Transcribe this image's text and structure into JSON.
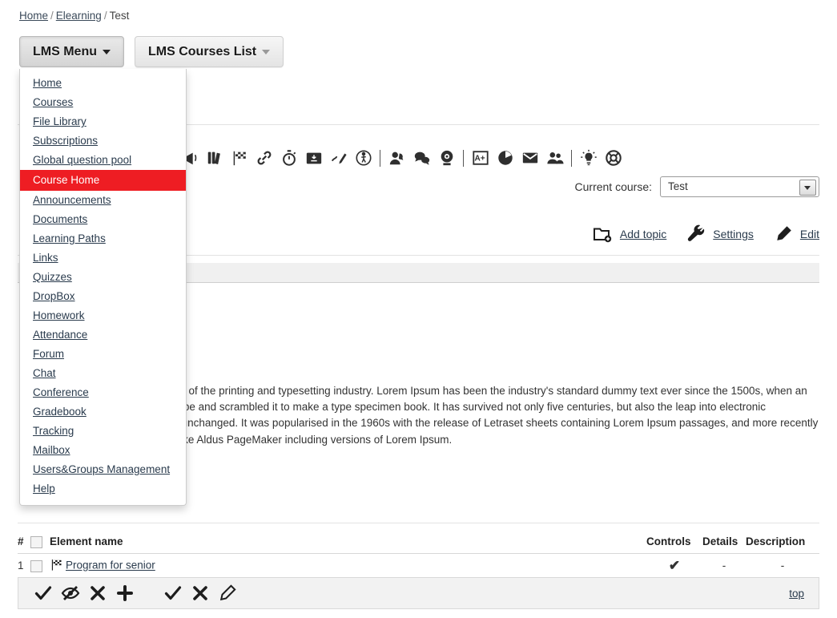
{
  "breadcrumb": {
    "items": [
      {
        "label": "Home",
        "link": true
      },
      {
        "label": "Elearning",
        "link": true
      },
      {
        "label": "Test",
        "link": false
      }
    ],
    "separator": "/"
  },
  "toolbar_buttons": {
    "lms_menu": "LMS Menu",
    "lms_courses_list": "LMS Courses List"
  },
  "dropdown": {
    "selected": "Course Home",
    "items": [
      {
        "label": "Home",
        "selected": false
      },
      {
        "label": "Courses",
        "selected": false
      },
      {
        "label": "File Library",
        "selected": false
      },
      {
        "label": "Subscriptions",
        "selected": false
      },
      {
        "label": "Global question pool",
        "selected": false
      },
      {
        "label": "Course Home",
        "selected": true
      },
      {
        "label": "Announcements",
        "selected": false
      },
      {
        "label": "Documents",
        "selected": false
      },
      {
        "label": "Learning Paths",
        "selected": false
      },
      {
        "label": "Links",
        "selected": false
      },
      {
        "label": "Quizzes",
        "selected": false
      },
      {
        "label": "DropBox",
        "selected": false
      },
      {
        "label": "Homework",
        "selected": false
      },
      {
        "label": "Attendance",
        "selected": false
      },
      {
        "label": "Forum",
        "selected": false
      },
      {
        "label": "Chat",
        "selected": false
      },
      {
        "label": "Conference",
        "selected": false
      },
      {
        "label": "Gradebook",
        "selected": false
      },
      {
        "label": "Tracking",
        "selected": false
      },
      {
        "label": "Mailbox",
        "selected": false
      },
      {
        "label": "Users&Groups Management",
        "selected": false
      },
      {
        "label": "Help",
        "selected": false
      }
    ]
  },
  "icon_toolbar": {
    "icons": [
      {
        "name": "home-icon"
      },
      {
        "name": "chart-board-icon"
      },
      {
        "name": "bank-icon"
      },
      {
        "name": "books-stack-icon"
      },
      {
        "name": "refresh-icon"
      },
      {
        "name": "separator"
      },
      {
        "name": "presentation-icon"
      },
      {
        "name": "megaphone-icon"
      },
      {
        "name": "books-icon"
      },
      {
        "name": "checkered-flag-icon"
      },
      {
        "name": "link-icon"
      },
      {
        "name": "stopwatch-icon"
      },
      {
        "name": "dropbox-inbox-icon"
      },
      {
        "name": "homework-pen-icon"
      },
      {
        "name": "attendance-walk-icon"
      },
      {
        "name": "separator"
      },
      {
        "name": "forum-icon"
      },
      {
        "name": "chat-icon"
      },
      {
        "name": "webcam-icon"
      },
      {
        "name": "separator"
      },
      {
        "name": "gradebook-icon"
      },
      {
        "name": "tracking-pie-icon"
      },
      {
        "name": "mailbox-icon"
      },
      {
        "name": "users-groups-icon"
      },
      {
        "name": "separator"
      },
      {
        "name": "help-bulb-icon"
      },
      {
        "name": "lifebuoy-icon"
      }
    ]
  },
  "current_course": {
    "label": "Current course:",
    "value": "Test",
    "options": [
      "Test"
    ]
  },
  "actions": [
    {
      "label": "Add topic",
      "icon": "add-folder-icon"
    },
    {
      "label": "Settings",
      "icon": "wrench-icon"
    },
    {
      "label": "Edit",
      "icon": "pencil-icon"
    }
  ],
  "body_text": "Lorem Ipsum is simply dummy text of the printing and typesetting industry. Lorem Ipsum has been the industry's standard dummy text ever since the 1500s, when an unknown printer took a galley of type and scrambled it to make a type specimen book. It has survived not only five centuries, but also the leap into electronic typesetting, remaining essentially unchanged. It was popularised in the 1960s with the release of Letraset sheets containing Lorem Ipsum passages, and more recently with desktop publishing software like Aldus PageMaker including versions of Lorem Ipsum.",
  "element_table": {
    "headers": {
      "num": "#",
      "name": "Element name",
      "controls": "Controls",
      "details": "Details",
      "description": "Description"
    },
    "rows": [
      {
        "num": "1",
        "name": "Program for senior",
        "icon": "checkered-flag-icon",
        "controls": "✔",
        "details": "-",
        "description": "-"
      }
    ]
  },
  "bottom_bar": {
    "icons": [
      {
        "name": "check-icon",
        "glyph": "✔"
      },
      {
        "name": "hide-eye-icon",
        "glyph": "eye-slash"
      },
      {
        "name": "cross-icon",
        "glyph": "✖"
      },
      {
        "name": "plus-icon",
        "glyph": "✚"
      },
      {
        "name": "check-icon-2",
        "glyph": "✔"
      },
      {
        "name": "cross-icon-2",
        "glyph": "✖"
      },
      {
        "name": "pencil-icon",
        "glyph": "pencil"
      }
    ],
    "top_link": "top"
  },
  "colors": {
    "accent_red": "#ee1d23",
    "link": "#2a3b4d",
    "band_grey": "#f0f0f0",
    "bottom_bar": "#f2f2f2"
  }
}
